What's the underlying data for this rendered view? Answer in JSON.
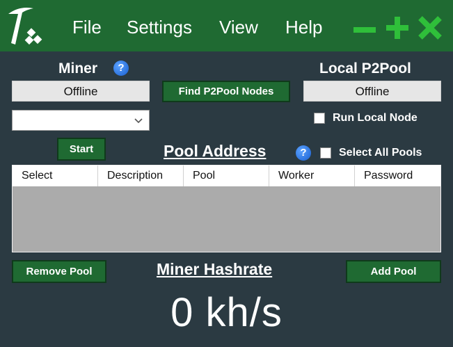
{
  "menu": {
    "file": "File",
    "settings": "Settings",
    "view": "View",
    "help": "Help"
  },
  "window_controls": {
    "minimize": "minimize-icon",
    "maximize": "plus-icon",
    "close": "close-icon",
    "color": "#2fbf3a"
  },
  "miner": {
    "label": "Miner",
    "status": "Offline",
    "start_label": "Start",
    "selected": ""
  },
  "find_nodes_label": "Find P2Pool Nodes",
  "local_p2pool": {
    "label": "Local P2Pool",
    "status": "Offline",
    "run_local_label": "Run Local Node"
  },
  "pool": {
    "label": "Pool Address",
    "select_all_label": "Select All Pools",
    "columns": [
      "Select",
      "Description",
      "Pool",
      "Worker",
      "Password"
    ],
    "remove_label": "Remove Pool",
    "add_label": "Add Pool"
  },
  "hashrate": {
    "label": "Miner Hashrate",
    "value": "0 kh/s"
  },
  "colors": {
    "accent": "#1f6a32",
    "background": "#2b3a42",
    "help": "#1a5fd0"
  }
}
